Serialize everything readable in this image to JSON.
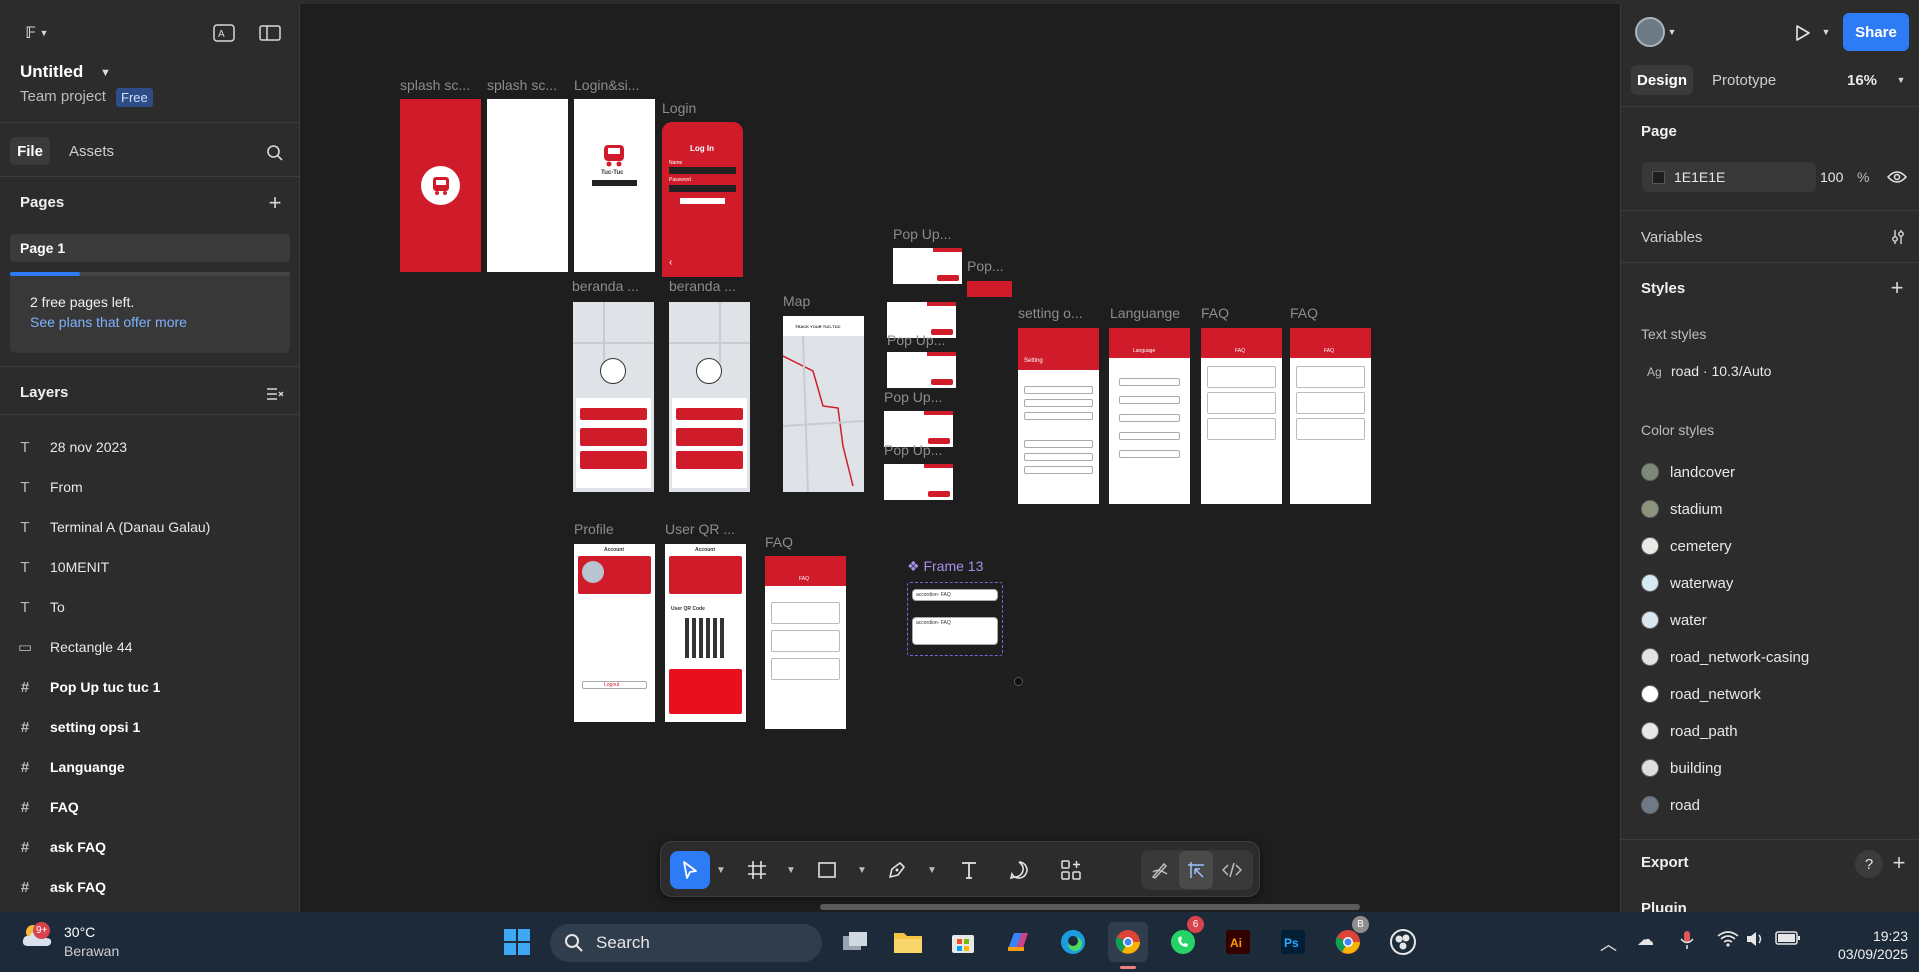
{
  "file": {
    "title": "Untitled",
    "project": "Team project",
    "plan_badge": "Free"
  },
  "left_tabs": {
    "file": "File",
    "assets": "Assets"
  },
  "pages": {
    "heading": "Pages",
    "items": [
      "Page 1"
    ],
    "free_pages_text": "2 free pages left.",
    "plans_link": "See plans that offer more",
    "free_pages_used_fraction": 0.25
  },
  "layers": {
    "heading": "Layers",
    "items": [
      {
        "icon": "text-icon",
        "glyph": "T",
        "label": "28 nov 2023",
        "bold": false
      },
      {
        "icon": "text-icon",
        "glyph": "T",
        "label": "From",
        "bold": false
      },
      {
        "icon": "text-icon",
        "glyph": "T",
        "label": "Terminal A (Danau Galau)",
        "bold": false
      },
      {
        "icon": "text-icon",
        "glyph": "T",
        "label": "10MENIT",
        "bold": false
      },
      {
        "icon": "text-icon",
        "glyph": "T",
        "label": "To",
        "bold": false
      },
      {
        "icon": "rectangle-icon",
        "glyph": "▭",
        "label": "Rectangle 44",
        "bold": false
      },
      {
        "icon": "frame-icon",
        "glyph": "#",
        "label": "Pop Up tuc tuc 1",
        "bold": true
      },
      {
        "icon": "frame-icon",
        "glyph": "#",
        "label": "setting opsi 1",
        "bold": true
      },
      {
        "icon": "frame-icon",
        "glyph": "#",
        "label": "Languange",
        "bold": true
      },
      {
        "icon": "frame-icon",
        "glyph": "#",
        "label": "FAQ",
        "bold": true
      },
      {
        "icon": "frame-icon",
        "glyph": "#",
        "label": "ask FAQ",
        "bold": true
      },
      {
        "icon": "frame-icon",
        "glyph": "#",
        "label": "ask FAQ",
        "bold": true
      }
    ]
  },
  "canvas": {
    "frame_labels": {
      "splash1": "splash sc...",
      "splash2": "splash sc...",
      "loginsi": "Login&si...",
      "login": "Login",
      "popup1": "Pop Up...",
      "pop_small": "Pop...",
      "beranda1": "beranda ...",
      "beranda2": "beranda ...",
      "map": "Map",
      "popup2": "Pop Up...",
      "popup3": "Pop Up...",
      "popup4": "Pop Up...",
      "setting": "setting o...",
      "language": "Languange",
      "faq1": "FAQ",
      "faq2": "FAQ",
      "profile": "Profile",
      "userqr": "User QR ...",
      "faq3": "FAQ",
      "frame13": "Frame 13"
    },
    "mini_text": {
      "app_name": "Tuc-Tuc",
      "login_title": "Log In",
      "login_btn": "Log In",
      "login_name": "Name",
      "login_password": "Password",
      "setting_title": "Setting",
      "language_title": "Language",
      "faq_title": "FAQ",
      "account": "Account",
      "logout": "Logout",
      "user_qr_code": "User QR Code",
      "accordion": "accordion- FAQ",
      "track": "TRACK YOUR TUC-TUC"
    }
  },
  "toolbar": {
    "tools": [
      "move-tool",
      "frame-tool",
      "shape-tool",
      "pen-tool",
      "text-tool",
      "comment-tool",
      "actions-tool"
    ],
    "modes": [
      "draw-mode",
      "design-mode",
      "dev-mode"
    ]
  },
  "right": {
    "share": "Share",
    "tabs": {
      "design": "Design",
      "prototype": "Prototype"
    },
    "zoom": "16%",
    "page_heading": "Page",
    "page_fill_hex": "1E1E1E",
    "page_fill_opacity": "100",
    "page_fill_unit": "%",
    "variables": "Variables",
    "styles": "Styles",
    "text_styles": "Text styles",
    "text_style_prefix": "Ag",
    "text_style_item": "road · 10.3/Auto",
    "color_styles": "Color styles",
    "color_items": [
      {
        "name": "landcover",
        "color": "#7d8a78"
      },
      {
        "name": "stadium",
        "color": "#8c9480"
      },
      {
        "name": "cemetery",
        "color": "#e9ebe7"
      },
      {
        "name": "waterway",
        "color": "#d6e8f2"
      },
      {
        "name": "water",
        "color": "#d9e7f0"
      },
      {
        "name": "road_network-casing",
        "color": "#e4e4e4"
      },
      {
        "name": "road_network",
        "color": "#ffffff"
      },
      {
        "name": "road_path",
        "color": "#e8e8e8"
      },
      {
        "name": "building",
        "color": "#dedede"
      },
      {
        "name": "road",
        "color": "#6e7a86"
      }
    ],
    "export": "Export",
    "plugin": "Plugin",
    "help": "?"
  },
  "taskbar": {
    "weather_temp": "30°C",
    "weather_desc": "Berawan",
    "weather_badge": "9+",
    "search": "Search",
    "whatsapp_badge": "6",
    "chrome_badge": "B",
    "time": "19:23",
    "date": "03/09/2025"
  }
}
